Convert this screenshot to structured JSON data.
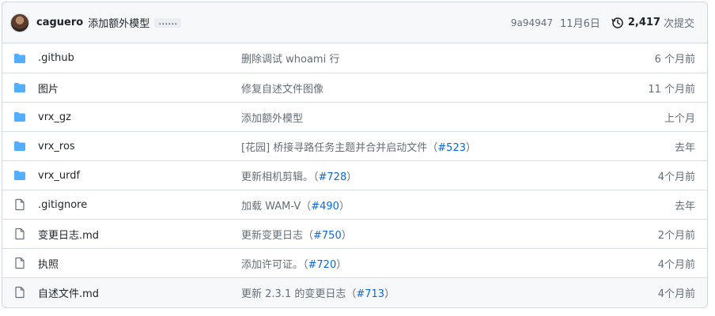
{
  "header": {
    "author": "caguero",
    "message": "添加额外模型",
    "ellipsis": "……",
    "sha": "9a94947",
    "date": "11月6日",
    "commit_count": "2,417",
    "commits_word": "次提交"
  },
  "rows": [
    {
      "type": "folder",
      "name": ".github",
      "msg": "删除调试 whoami 行",
      "msg_pre": "",
      "pr": "",
      "msg_post": "",
      "age": "6 个月前"
    },
    {
      "type": "folder",
      "name": "图片",
      "msg": "修复自述文件图像",
      "msg_pre": "",
      "pr": "",
      "msg_post": "",
      "age": "11 个月前"
    },
    {
      "type": "folder",
      "name": "vrx_gz",
      "msg": "添加额外模型",
      "msg_pre": "",
      "pr": "",
      "msg_post": "",
      "age": "上个月"
    },
    {
      "type": "folder",
      "name": "vrx_ros",
      "msg": "",
      "msg_pre": "[花园] 桥接寻路任务主题并合并启动文件（",
      "pr": "#523",
      "msg_post": "）",
      "age": "去年"
    },
    {
      "type": "folder",
      "name": "vrx_urdf",
      "msg": "",
      "msg_pre": "更新相机剪辑。（",
      "pr": "#728",
      "msg_post": "）",
      "age": "4个月前"
    },
    {
      "type": "file",
      "name": ".gitignore",
      "msg": "",
      "msg_pre": "加载 WAM-V（",
      "pr": "#490",
      "msg_post": "）",
      "age": "去年"
    },
    {
      "type": "file",
      "name": "变更日志.md",
      "msg": "",
      "msg_pre": "更新变更日志（",
      "pr": "#750",
      "msg_post": "）",
      "age": "2个月前"
    },
    {
      "type": "file",
      "name": "执照",
      "msg": "",
      "msg_pre": "添加许可证。（",
      "pr": "#720",
      "msg_post": "）",
      "age": "4个月前"
    },
    {
      "type": "file",
      "name": "自述文件.md",
      "msg": "",
      "msg_pre": "更新 2.3.1 的变更日志（",
      "pr": "#713",
      "msg_post": "）",
      "age": "4个月前"
    }
  ],
  "colors": {
    "folder": "#54aeff",
    "file": "#656d76",
    "link": "#0969da"
  },
  "icons": {
    "folder": "folder-icon",
    "file": "file-icon",
    "history": "history-icon"
  }
}
